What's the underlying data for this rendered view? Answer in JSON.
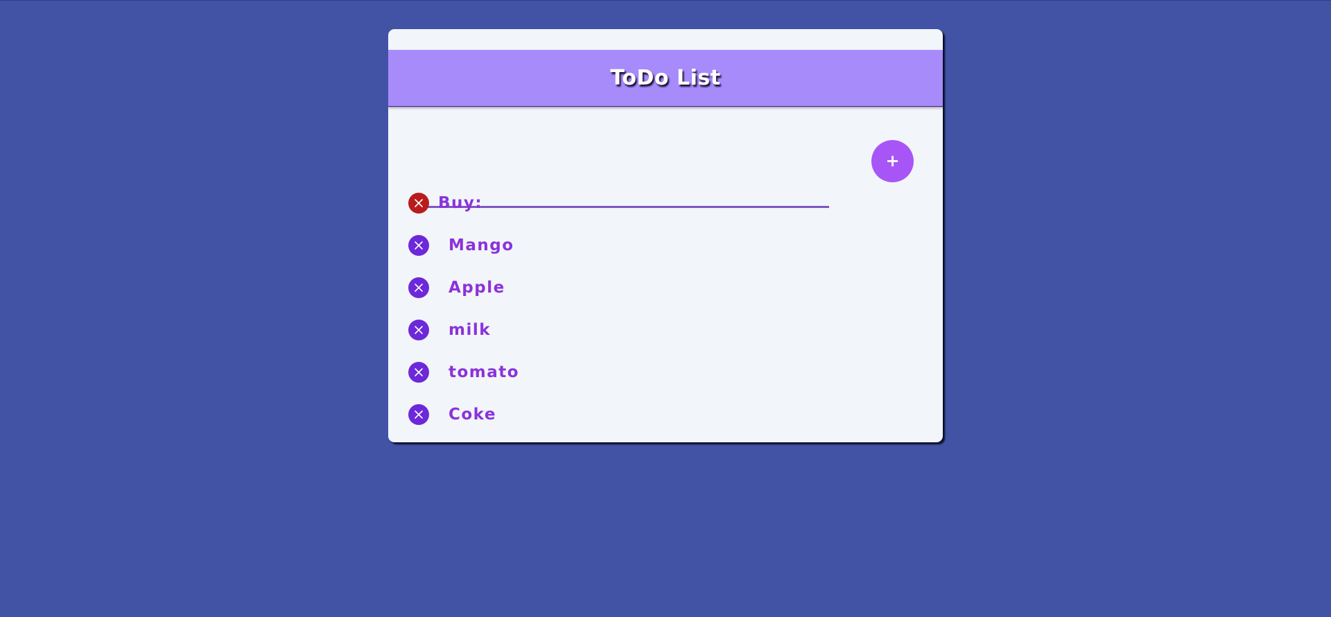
{
  "app": {
    "title": "ToDo List"
  },
  "input": {
    "value": "",
    "placeholder": ""
  },
  "add_button": {
    "label": "+"
  },
  "items": [
    {
      "label": "Buy:",
      "delete_color": "#b91c1c"
    },
    {
      "label": "Mango",
      "delete_color": "#6d28d9"
    },
    {
      "label": "Apple",
      "delete_color": "#6d28d9"
    },
    {
      "label": "milk",
      "delete_color": "#6d28d9"
    },
    {
      "label": "tomato",
      "delete_color": "#6d28d9"
    },
    {
      "label": "Coke",
      "delete_color": "#6d28d9"
    }
  ],
  "colors": {
    "background": "#4253a6",
    "card": "#f2f5f9",
    "header": "#a78bfa",
    "accent": "#a855f7",
    "item_text": "#8b32db"
  }
}
